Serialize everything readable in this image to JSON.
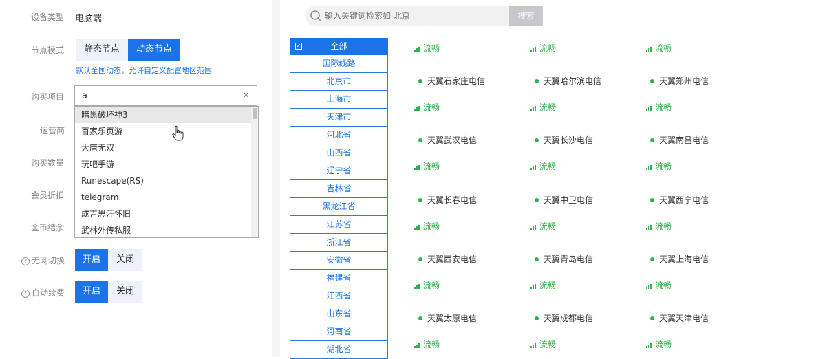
{
  "form": {
    "device_type_label": "设备类型",
    "device_type_value": "电脑端",
    "node_mode_label": "节点模式",
    "node_mode_options": [
      "静态节点",
      "动态节点"
    ],
    "node_mode_selected": "动态节点",
    "tip_text": "默认全国动态，",
    "tip_link": "允许自定义配置地区范围",
    "purchase_item_label": "购买项目",
    "purchase_item_value": "a",
    "clear_symbol": "×",
    "operator_label": "运营商",
    "quantity_label": "购买数量",
    "discount_label": "会员折扣",
    "coin_label": "金币结余",
    "no_net_switch_label": "无网切换",
    "auto_renew_label": "自动续费",
    "help_symbol": "?",
    "on_label": "开启",
    "off_label": "关闭",
    "dropdown_items": [
      "暗黑破坏神3",
      "百家乐页游",
      "大唐无双",
      "玩吧手游",
      "Runescape(RS)",
      "telegram",
      "成吉思汗怀旧",
      "武林外传私服"
    ],
    "dropdown_hover_index": 0
  },
  "search": {
    "placeholder": "输入关键词检索如 北京",
    "button_label": "搜索"
  },
  "regions": {
    "all_label": "全部",
    "check_symbol": "✓",
    "items": [
      "国际线路",
      "北京市",
      "上海市",
      "天津市",
      "河北省",
      "山西省",
      "辽宁省",
      "吉林省",
      "黑龙江省",
      "江苏省",
      "浙江省",
      "安徽省",
      "福建省",
      "江西省",
      "山东省",
      "河南省",
      "湖北省"
    ]
  },
  "nodes": {
    "status_text": "流畅",
    "status_color": "#2cb34a",
    "top_row_status": [
      "流畅",
      "流畅",
      "流畅"
    ],
    "groups": [
      [
        "天翼石家庄电信",
        "天翼哈尔滨电信",
        "天翼郑州电信"
      ],
      [
        "天翼武汉电信",
        "天翼长沙电信",
        "天翼南昌电信"
      ],
      [
        "天翼长春电信",
        "天翼中卫电信",
        "天翼西宁电信"
      ],
      [
        "天翼西安电信",
        "天翼青岛电信",
        "天翼上海电信"
      ],
      [
        "天翼太原电信",
        "天翼成都电信",
        "天翼天津电信"
      ]
    ]
  },
  "colors": {
    "accent": "#1a73e8",
    "ok_green": "#2cb34a"
  }
}
